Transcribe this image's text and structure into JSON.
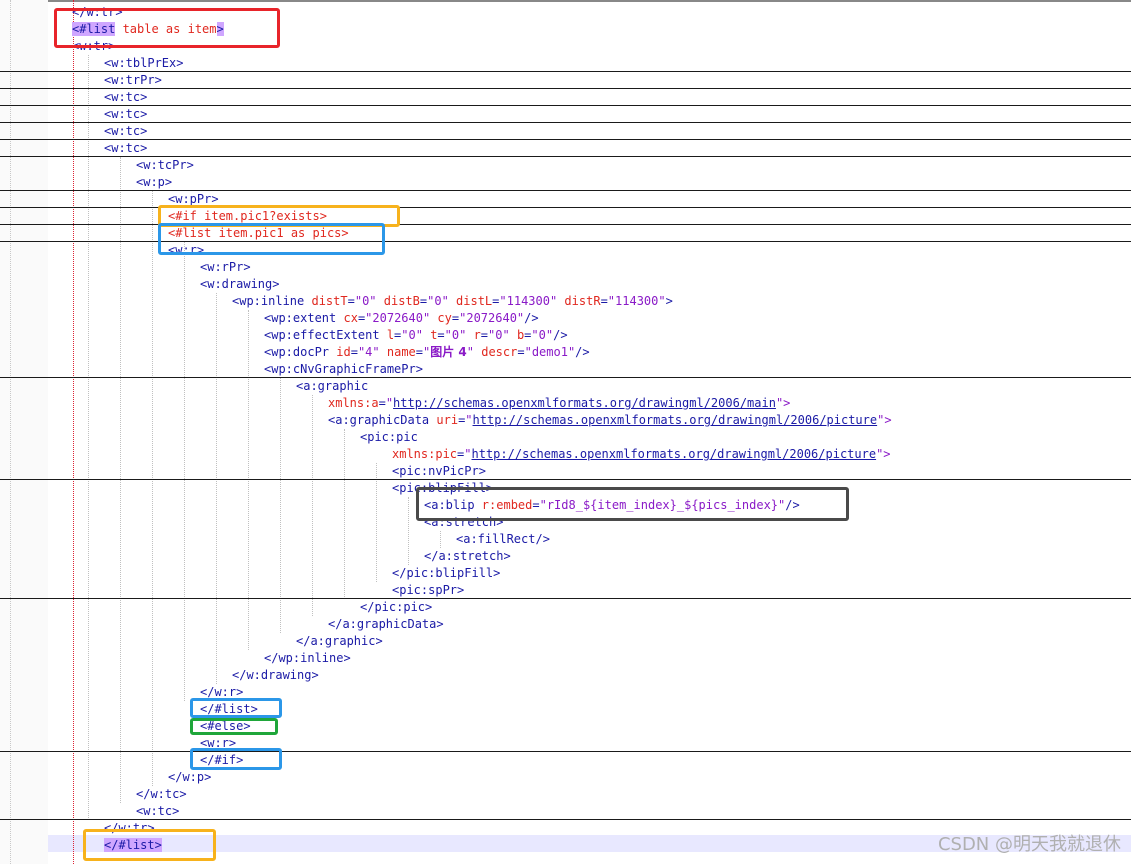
{
  "code_lines": [
    [
      "</w:tr>"
    ],
    [
      "<#list",
      " table as item",
      ">"
    ],
    [
      "<w:tr>"
    ],
    [
      "<w:tblPrEx>"
    ],
    [
      "<w:trPr>"
    ],
    [
      "<w:tc>"
    ],
    [
      "<w:tc>"
    ],
    [
      "<w:tc>"
    ],
    [
      "<w:tc>"
    ],
    [
      "<w:tcPr>"
    ],
    [
      "<w:p>"
    ],
    [
      "<w:pPr>"
    ],
    [
      "<#if item.pic1?exists>"
    ],
    [
      "<#list item.pic1 as pics>"
    ],
    [
      "<w:r>"
    ],
    [
      "<w:rPr>"
    ],
    [
      "<w:drawing>"
    ],
    [
      "<wp:inline",
      " distT",
      "=",
      "\"0\"",
      " distB",
      "=",
      "\"0\"",
      " distL",
      "=",
      "\"114300\"",
      " distR",
      "=",
      "\"114300\"",
      ">"
    ],
    [
      "<wp:extent",
      " cx",
      "=",
      "\"2072640\"",
      " cy",
      "=",
      "\"2072640\"",
      "/>"
    ],
    [
      "<wp:effectExtent",
      " l",
      "=",
      "\"0\"",
      " t",
      "=",
      "\"0\"",
      " r",
      "=",
      "\"0\"",
      " b",
      "=",
      "\"0\"",
      "/>"
    ],
    [
      "<wp:docPr",
      " id",
      "=",
      "\"4\"",
      " name",
      "=",
      "\"",
      "图片 4",
      "\"",
      " descr",
      "=",
      "\"demo1\"",
      "/>"
    ],
    [
      "<wp:cNvGraphicFramePr>"
    ],
    [
      "<a:graphic"
    ],
    [
      "xmlns:a",
      "=",
      "\"",
      "http://schemas.openxmlformats.org/drawingml/2006/main",
      "\">"
    ],
    [
      "<a:graphicData",
      " uri",
      "=",
      "\"",
      "http://schemas.openxmlformats.org/drawingml/2006/picture",
      "\">"
    ],
    [
      "<pic:pic"
    ],
    [
      "xmlns:pic",
      "=",
      "\"",
      "http://schemas.openxmlformats.org/drawingml/2006/picture",
      "\">"
    ],
    [
      "<pic:nvPicPr>"
    ],
    [
      "<pic:blipFill>"
    ],
    [
      "<a:blip",
      " r:embed",
      "=",
      "\"rId8_${item_index}_${pics_index}\"",
      "/>"
    ],
    [
      "<a:stretch>"
    ],
    [
      "<a:fillRect/>"
    ],
    [
      "</a:stretch>"
    ],
    [
      "</pic:blipFill>"
    ],
    [
      "<pic:spPr>"
    ],
    [
      "</pic:pic>"
    ],
    [
      "</a:graphicData>"
    ],
    [
      "</a:graphic>"
    ],
    [
      "</wp:inline>"
    ],
    [
      "</w:drawing>"
    ],
    [
      "</w:r>"
    ],
    [
      "</#list>"
    ],
    [
      "<#else>"
    ],
    [
      "<w:r>"
    ],
    [
      "</#if>"
    ],
    [
      "</w:p>"
    ],
    [
      "</w:tc>"
    ],
    [
      "<w:tc>"
    ],
    [
      "</w:tr>"
    ],
    [
      "</#list",
      ">"
    ]
  ],
  "colors": {
    "red_box": "#e8242a",
    "orange_box": "#f7b21c",
    "blue_box": "#2b97e8",
    "green_box": "#1fa63a",
    "dark_box": "#4a4a4a"
  },
  "watermark": "CSDN @明天我就退休"
}
